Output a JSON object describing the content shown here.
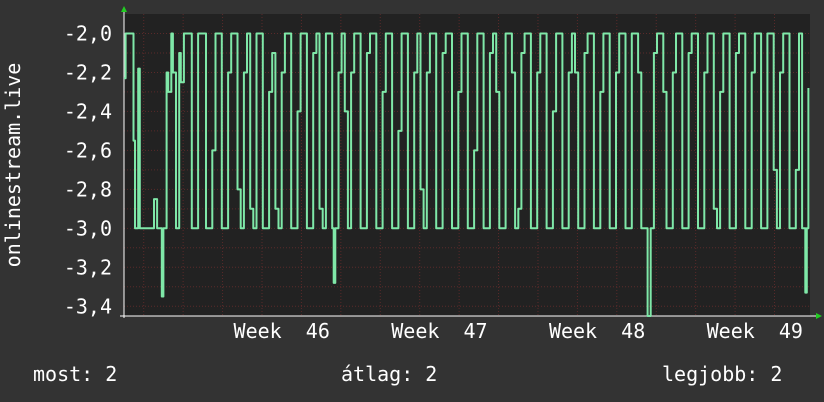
{
  "chart_data": {
    "type": "line",
    "ylabel": "onlinestream.live",
    "ylim": [
      -3.45,
      -1.9
    ],
    "y_ticks": [
      "-2,0",
      "-2,2",
      "-2,4",
      "-2,6",
      "-2,8",
      "-3,0",
      "-3,2",
      "-3,4"
    ],
    "y_tick_values": [
      -2.0,
      -2.2,
      -2.4,
      -2.6,
      -2.8,
      -3.0,
      -3.2,
      -3.4
    ],
    "x_ticks": [
      "Week  46",
      "Week  47",
      "Week  48",
      "Week  49"
    ],
    "x_tick_values": [
      1.0,
      2.0,
      3.0,
      4.0
    ],
    "xlim": [
      0.0,
      4.35
    ],
    "grid": true,
    "line_color": "#7fe8a8",
    "series": [
      {
        "values": [
          [
            0.0,
            -2.23
          ],
          [
            0.01,
            -2.0
          ],
          [
            0.05,
            -2.0
          ],
          [
            0.06,
            -2.55
          ],
          [
            0.07,
            -3.0
          ],
          [
            0.09,
            -2.18
          ],
          [
            0.1,
            -3.0
          ],
          [
            0.12,
            -3.0
          ],
          [
            0.14,
            -3.0
          ],
          [
            0.16,
            -3.0
          ],
          [
            0.18,
            -3.0
          ],
          [
            0.19,
            -2.85
          ],
          [
            0.21,
            -3.0
          ],
          [
            0.23,
            -3.0
          ],
          [
            0.24,
            -3.35
          ],
          [
            0.25,
            -3.0
          ],
          [
            0.27,
            -2.2
          ],
          [
            0.28,
            -2.3
          ],
          [
            0.3,
            -2.0
          ],
          [
            0.31,
            -2.2
          ],
          [
            0.33,
            -3.0
          ],
          [
            0.35,
            -2.1
          ],
          [
            0.36,
            -2.25
          ],
          [
            0.38,
            -2.0
          ],
          [
            0.41,
            -2.0
          ],
          [
            0.43,
            -3.0
          ],
          [
            0.45,
            -3.0
          ],
          [
            0.47,
            -2.0
          ],
          [
            0.5,
            -2.0
          ],
          [
            0.52,
            -3.0
          ],
          [
            0.54,
            -3.0
          ],
          [
            0.56,
            -2.6
          ],
          [
            0.58,
            -2.0
          ],
          [
            0.6,
            -2.0
          ],
          [
            0.62,
            -3.0
          ],
          [
            0.64,
            -3.0
          ],
          [
            0.66,
            -2.2
          ],
          [
            0.68,
            -2.0
          ],
          [
            0.7,
            -2.0
          ],
          [
            0.72,
            -2.8
          ],
          [
            0.74,
            -3.0
          ],
          [
            0.76,
            -2.2
          ],
          [
            0.78,
            -2.0
          ],
          [
            0.8,
            -2.9
          ],
          [
            0.82,
            -3.0
          ],
          [
            0.84,
            -2.0
          ],
          [
            0.86,
            -2.0
          ],
          [
            0.88,
            -3.0
          ],
          [
            0.9,
            -3.0
          ],
          [
            0.92,
            -2.3
          ],
          [
            0.94,
            -2.1
          ],
          [
            0.96,
            -2.9
          ],
          [
            0.98,
            -3.0
          ],
          [
            1.0,
            -2.2
          ],
          [
            1.02,
            -2.0
          ],
          [
            1.04,
            -2.0
          ],
          [
            1.06,
            -3.0
          ],
          [
            1.08,
            -3.0
          ],
          [
            1.1,
            -2.4
          ],
          [
            1.12,
            -2.0
          ],
          [
            1.14,
            -2.0
          ],
          [
            1.16,
            -3.0
          ],
          [
            1.18,
            -3.0
          ],
          [
            1.2,
            -2.1
          ],
          [
            1.22,
            -2.0
          ],
          [
            1.24,
            -2.9
          ],
          [
            1.26,
            -3.0
          ],
          [
            1.28,
            -2.0
          ],
          [
            1.3,
            -2.0
          ],
          [
            1.32,
            -3.0
          ],
          [
            1.33,
            -3.28
          ],
          [
            1.34,
            -3.0
          ],
          [
            1.36,
            -2.2
          ],
          [
            1.38,
            -2.0
          ],
          [
            1.4,
            -2.4
          ],
          [
            1.42,
            -3.0
          ],
          [
            1.44,
            -2.2
          ],
          [
            1.46,
            -2.0
          ],
          [
            1.48,
            -2.0
          ],
          [
            1.5,
            -3.0
          ],
          [
            1.52,
            -3.0
          ],
          [
            1.54,
            -2.1
          ],
          [
            1.56,
            -2.0
          ],
          [
            1.58,
            -2.0
          ],
          [
            1.6,
            -3.0
          ],
          [
            1.62,
            -3.0
          ],
          [
            1.64,
            -2.3
          ],
          [
            1.66,
            -2.0
          ],
          [
            1.68,
            -2.0
          ],
          [
            1.7,
            -3.0
          ],
          [
            1.72,
            -3.0
          ],
          [
            1.74,
            -2.5
          ],
          [
            1.76,
            -2.0
          ],
          [
            1.78,
            -2.0
          ],
          [
            1.8,
            -3.0
          ],
          [
            1.82,
            -3.0
          ],
          [
            1.84,
            -2.2
          ],
          [
            1.86,
            -2.0
          ],
          [
            1.88,
            -2.8
          ],
          [
            1.9,
            -3.0
          ],
          [
            1.92,
            -2.2
          ],
          [
            1.94,
            -2.0
          ],
          [
            1.96,
            -2.0
          ],
          [
            1.98,
            -3.0
          ],
          [
            2.0,
            -3.0
          ],
          [
            2.02,
            -2.1
          ],
          [
            2.04,
            -2.0
          ],
          [
            2.06,
            -2.0
          ],
          [
            2.08,
            -3.0
          ],
          [
            2.1,
            -3.0
          ],
          [
            2.12,
            -2.3
          ],
          [
            2.14,
            -2.0
          ],
          [
            2.16,
            -2.0
          ],
          [
            2.18,
            -3.0
          ],
          [
            2.2,
            -3.0
          ],
          [
            2.22,
            -2.6
          ],
          [
            2.24,
            -2.0
          ],
          [
            2.26,
            -2.0
          ],
          [
            2.28,
            -3.0
          ],
          [
            2.3,
            -3.0
          ],
          [
            2.32,
            -2.1
          ],
          [
            2.34,
            -2.0
          ],
          [
            2.36,
            -2.3
          ],
          [
            2.38,
            -3.0
          ],
          [
            2.4,
            -3.0
          ],
          [
            2.42,
            -2.0
          ],
          [
            2.44,
            -2.0
          ],
          [
            2.46,
            -2.2
          ],
          [
            2.48,
            -3.0
          ],
          [
            2.5,
            -2.9
          ],
          [
            2.52,
            -2.1
          ],
          [
            2.54,
            -2.0
          ],
          [
            2.56,
            -2.0
          ],
          [
            2.58,
            -3.0
          ],
          [
            2.6,
            -3.0
          ],
          [
            2.62,
            -2.2
          ],
          [
            2.64,
            -2.0
          ],
          [
            2.66,
            -2.0
          ],
          [
            2.68,
            -3.0
          ],
          [
            2.7,
            -3.0
          ],
          [
            2.72,
            -2.4
          ],
          [
            2.74,
            -2.0
          ],
          [
            2.76,
            -2.0
          ],
          [
            2.78,
            -3.0
          ],
          [
            2.8,
            -3.0
          ],
          [
            2.82,
            -2.2
          ],
          [
            2.84,
            -2.0
          ],
          [
            2.86,
            -2.2
          ],
          [
            2.88,
            -3.0
          ],
          [
            2.9,
            -3.0
          ],
          [
            2.92,
            -2.1
          ],
          [
            2.94,
            -2.0
          ],
          [
            2.96,
            -2.0
          ],
          [
            2.98,
            -3.0
          ],
          [
            3.0,
            -3.0
          ],
          [
            3.02,
            -2.3
          ],
          [
            3.04,
            -2.0
          ],
          [
            3.06,
            -2.0
          ],
          [
            3.08,
            -3.0
          ],
          [
            3.1,
            -3.0
          ],
          [
            3.12,
            -2.2
          ],
          [
            3.14,
            -2.0
          ],
          [
            3.16,
            -2.0
          ],
          [
            3.18,
            -3.0
          ],
          [
            3.2,
            -3.0
          ],
          [
            3.22,
            -2.0
          ],
          [
            3.24,
            -2.0
          ],
          [
            3.26,
            -2.2
          ],
          [
            3.28,
            -3.0
          ],
          [
            3.3,
            -3.0
          ],
          [
            3.32,
            -3.45
          ],
          [
            3.34,
            -3.0
          ],
          [
            3.36,
            -2.1
          ],
          [
            3.38,
            -2.0
          ],
          [
            3.4,
            -2.0
          ],
          [
            3.42,
            -2.3
          ],
          [
            3.44,
            -3.0
          ],
          [
            3.46,
            -3.0
          ],
          [
            3.48,
            -2.2
          ],
          [
            3.5,
            -2.0
          ],
          [
            3.52,
            -2.0
          ],
          [
            3.54,
            -3.0
          ],
          [
            3.56,
            -3.0
          ],
          [
            3.58,
            -2.1
          ],
          [
            3.6,
            -2.0
          ],
          [
            3.62,
            -2.0
          ],
          [
            3.64,
            -3.0
          ],
          [
            3.66,
            -3.0
          ],
          [
            3.68,
            -2.2
          ],
          [
            3.7,
            -2.0
          ],
          [
            3.72,
            -2.0
          ],
          [
            3.74,
            -2.9
          ],
          [
            3.76,
            -3.0
          ],
          [
            3.78,
            -2.3
          ],
          [
            3.8,
            -2.0
          ],
          [
            3.82,
            -2.0
          ],
          [
            3.84,
            -3.0
          ],
          [
            3.86,
            -3.0
          ],
          [
            3.88,
            -2.1
          ],
          [
            3.9,
            -2.0
          ],
          [
            3.92,
            -2.0
          ],
          [
            3.94,
            -3.0
          ],
          [
            3.96,
            -3.0
          ],
          [
            3.98,
            -2.2
          ],
          [
            4.0,
            -2.0
          ],
          [
            4.02,
            -2.0
          ],
          [
            4.04,
            -3.0
          ],
          [
            4.06,
            -3.0
          ],
          [
            4.08,
            -2.0
          ],
          [
            4.1,
            -2.0
          ],
          [
            4.12,
            -2.7
          ],
          [
            4.14,
            -3.0
          ],
          [
            4.16,
            -2.2
          ],
          [
            4.18,
            -2.0
          ],
          [
            4.2,
            -2.0
          ],
          [
            4.22,
            -3.0
          ],
          [
            4.24,
            -3.0
          ],
          [
            4.26,
            -2.7
          ],
          [
            4.28,
            -2.0
          ],
          [
            4.3,
            -3.0
          ],
          [
            4.31,
            -3.0
          ],
          [
            4.32,
            -3.33
          ],
          [
            4.33,
            -3.0
          ],
          [
            4.34,
            -2.28
          ]
        ]
      }
    ]
  },
  "stats": {
    "current": "most: 2",
    "average": "átlag: 2",
    "best": "legjobb: 2"
  }
}
